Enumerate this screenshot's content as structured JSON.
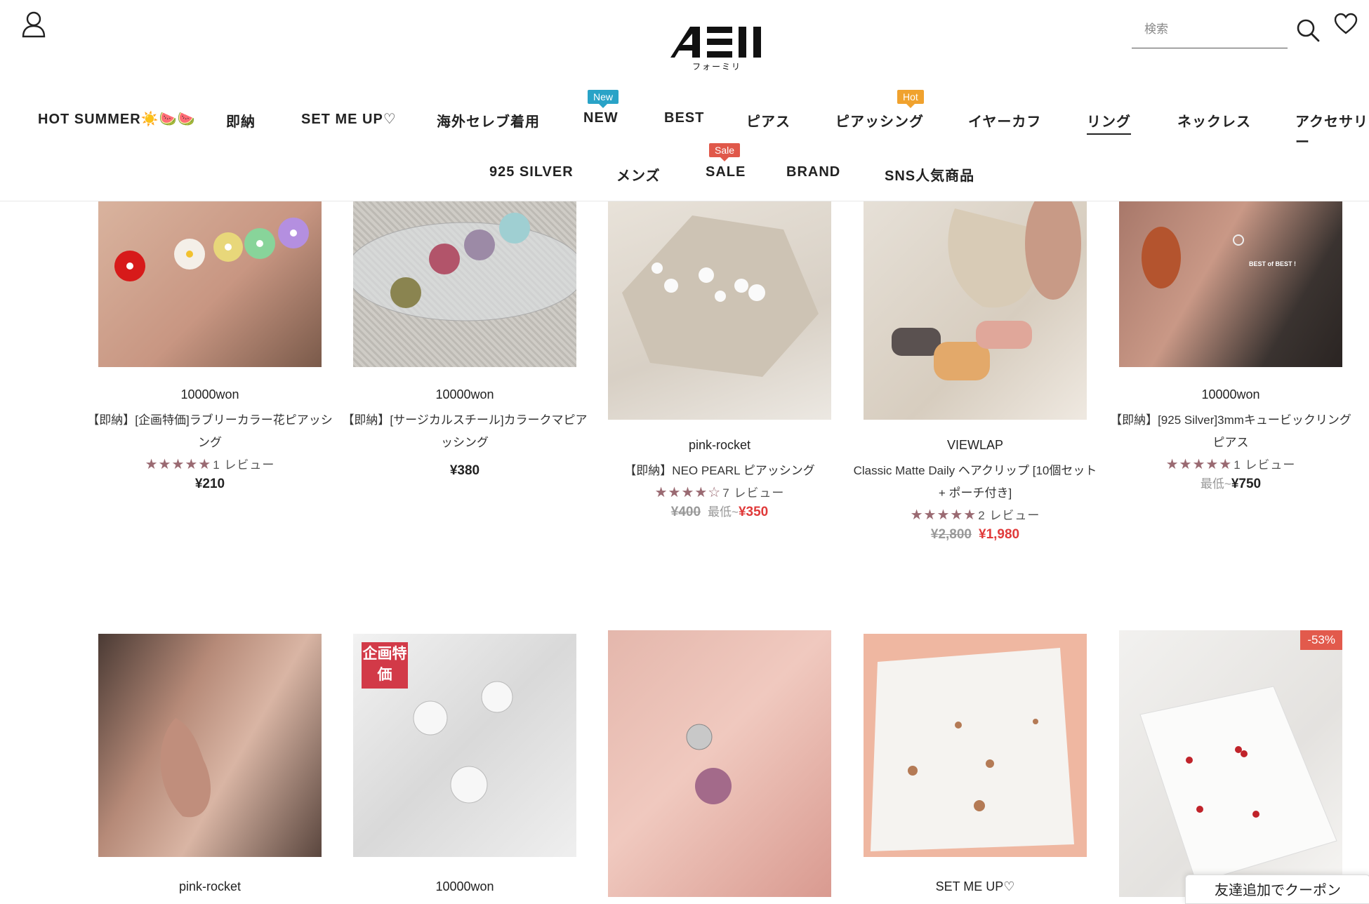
{
  "header": {
    "logo_sub": "フォーミリ",
    "search_placeholder": "検索"
  },
  "nav_row1": [
    {
      "label": "HOT SUMMER☀️🍉🍉",
      "badge": ""
    },
    {
      "label": "即納",
      "badge": ""
    },
    {
      "label": "SET ME UP♡",
      "badge": ""
    },
    {
      "label": "海外セレブ着用",
      "badge": ""
    },
    {
      "label": "NEW",
      "badge": "New"
    },
    {
      "label": "BEST",
      "badge": ""
    },
    {
      "label": "ピアス",
      "badge": ""
    },
    {
      "label": "ピアッシング",
      "badge": "Hot"
    },
    {
      "label": "イヤーカフ",
      "badge": ""
    },
    {
      "label": "リング",
      "badge": "",
      "active": true
    },
    {
      "label": "ネックレス",
      "badge": ""
    },
    {
      "label": "アクセサリー",
      "badge": ""
    }
  ],
  "nav_row2": [
    {
      "label": "925 SILVER",
      "badge": ""
    },
    {
      "label": "メンズ",
      "badge": ""
    },
    {
      "label": "SALE",
      "badge": "Sale"
    },
    {
      "label": "BRAND",
      "badge": ""
    },
    {
      "label": "SNS人気商品",
      "badge": ""
    }
  ],
  "badge_colors": {
    "New": "#29a3c7",
    "Hot": "#f0a22e",
    "Sale": "#e0584a"
  },
  "products_row1": [
    {
      "brand": "10000won",
      "name": "【即納】[企画特価]ラブリーカラー花ピアッシング",
      "rating": 5,
      "reviews": "1 レビュー",
      "price_old": "",
      "price_min": "",
      "price": "¥210"
    },
    {
      "brand": "10000won",
      "name": "【即納】[サージカルスチール]カラークマピアッシング",
      "rating": 0,
      "reviews": "",
      "price_old": "",
      "price_min": "",
      "price": "¥380"
    },
    {
      "brand": "pink-rocket",
      "name": "【即納】NEO PEARL ピアッシング",
      "rating": 4.5,
      "reviews": "7 レビュー",
      "price_old": "¥400",
      "price_min": "最低~",
      "price": "¥350"
    },
    {
      "brand": "VIEWLAP",
      "name": "Classic Matte Daily ヘアクリップ [10個セット + ポーチ付き]",
      "rating": 5,
      "reviews": "2 レビュー",
      "price_old": "¥2,800",
      "price_min": "",
      "price": "¥1,980"
    },
    {
      "brand": "10000won",
      "name": "【即納】[925 Silver]3mmキュービックリングピアス",
      "rating": 5,
      "reviews": "1 レビュー",
      "price_old": "",
      "price_min": "最低~",
      "price": "¥750"
    }
  ],
  "products_row2": [
    {
      "brand": "pink-rocket",
      "tag": ""
    },
    {
      "brand": "10000won",
      "tag": "企画特価"
    },
    {
      "brand": "",
      "tag": ""
    },
    {
      "brand": "SET ME UP♡",
      "tag": ""
    },
    {
      "brand": "",
      "tag": "",
      "discount": "-53%"
    }
  ],
  "overlay_text": {
    "best_of_best": "BEST of BEST !"
  },
  "coupon_label": "友達追加でクーポン"
}
